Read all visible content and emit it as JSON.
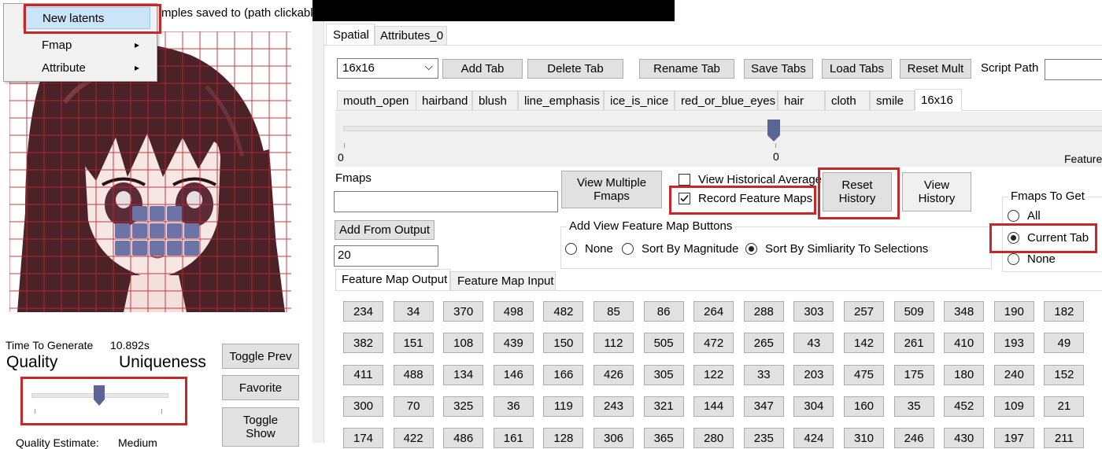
{
  "context_menu": {
    "items": [
      {
        "label": "New latents"
      },
      {
        "label": "Fmap",
        "submenu": "▸"
      },
      {
        "label": "Attribute",
        "submenu": "▸"
      }
    ]
  },
  "header_text": "mples saved to (path clickable)",
  "top_tabs": [
    "Spatial",
    "Attributes_0"
  ],
  "toolbar": {
    "size_select": "16x16",
    "dropdown_arrow": "⌵",
    "add_tab": "Add Tab",
    "delete_tab": "Delete Tab",
    "rename_tab": "Rename Tab",
    "save_tabs": "Save Tabs",
    "load_tabs": "Load Tabs",
    "reset_mult": "Reset Mult",
    "script_path_label": "Script Path",
    "script_path_value": ""
  },
  "attr_tabs": [
    "mouth_open",
    "hairband",
    "blush",
    "line_emphasis",
    "ice_is_nice",
    "red_or_blue_eyes",
    "hair",
    "cloth",
    "smile",
    "16x16"
  ],
  "attr_slider": {
    "value": 0,
    "min_label": "0",
    "mid_label": "0",
    "right_label": "Feature",
    "fraction": 0.5
  },
  "fmaps": {
    "label": "Fmaps",
    "field_value": "",
    "add_from_output": "Add From Output",
    "count_value": "20",
    "view_multiple_line1": "View Multiple",
    "view_multiple_line2": "Fmaps",
    "view_historical_average": "View Historical Average",
    "view_historical_checked": false,
    "record_feature_maps": "Record Feature Maps",
    "record_checked": true,
    "reset_history_line1": "Reset",
    "reset_history_line2": "History",
    "view_history_line1": "View",
    "view_history_line2": "History"
  },
  "add_view_group": {
    "title": "Add View Feature Map Buttons",
    "options": [
      "None",
      "Sort By Magnitude",
      "Sort By Simliarity To Selections"
    ],
    "selected": "Sort By Simliarity To Selections"
  },
  "fmaps_to_get": {
    "title": "Fmaps To Get",
    "options": [
      "All",
      "Current Tab",
      "None"
    ],
    "selected": "Current Tab"
  },
  "output_tabs": [
    "Feature Map Output",
    "Feature Map Input"
  ],
  "feature_map_grid": [
    [
      "234",
      "34",
      "370",
      "498",
      "482",
      "85",
      "86",
      "264",
      "288",
      "303",
      "257",
      "509",
      "348",
      "190",
      "182"
    ],
    [
      "382",
      "151",
      "108",
      "439",
      "150",
      "112",
      "505",
      "472",
      "265",
      "43",
      "142",
      "261",
      "410",
      "193",
      "49"
    ],
    [
      "411",
      "488",
      "134",
      "146",
      "166",
      "426",
      "305",
      "122",
      "33",
      "203",
      "475",
      "175",
      "180",
      "240",
      "152"
    ],
    [
      "300",
      "70",
      "325",
      "36",
      "119",
      "243",
      "321",
      "144",
      "347",
      "304",
      "160",
      "35",
      "452",
      "109",
      "21"
    ],
    [
      "174",
      "422",
      "486",
      "161",
      "128",
      "306",
      "365",
      "280",
      "235",
      "424",
      "310",
      "246",
      "430",
      "197",
      "211"
    ]
  ],
  "left_panel": {
    "time_label": "Time To Generate",
    "time_value": "10.892s",
    "quality_label": "Quality",
    "uniqueness_label": "Uniqueness",
    "quality_slider_fraction": 0.5,
    "toggle_prev": "Toggle Prev",
    "favorite": "Favorite",
    "toggle_show_line1": "Toggle",
    "toggle_show_line2": "Show",
    "quality_estimate_label": "Quality Estimate:",
    "quality_estimate_value": "Medium"
  },
  "colors": {
    "highlight": "#c62828",
    "grid_line": "#c0282d",
    "selection": "#6b74a5",
    "button": "#e1e1e1"
  }
}
